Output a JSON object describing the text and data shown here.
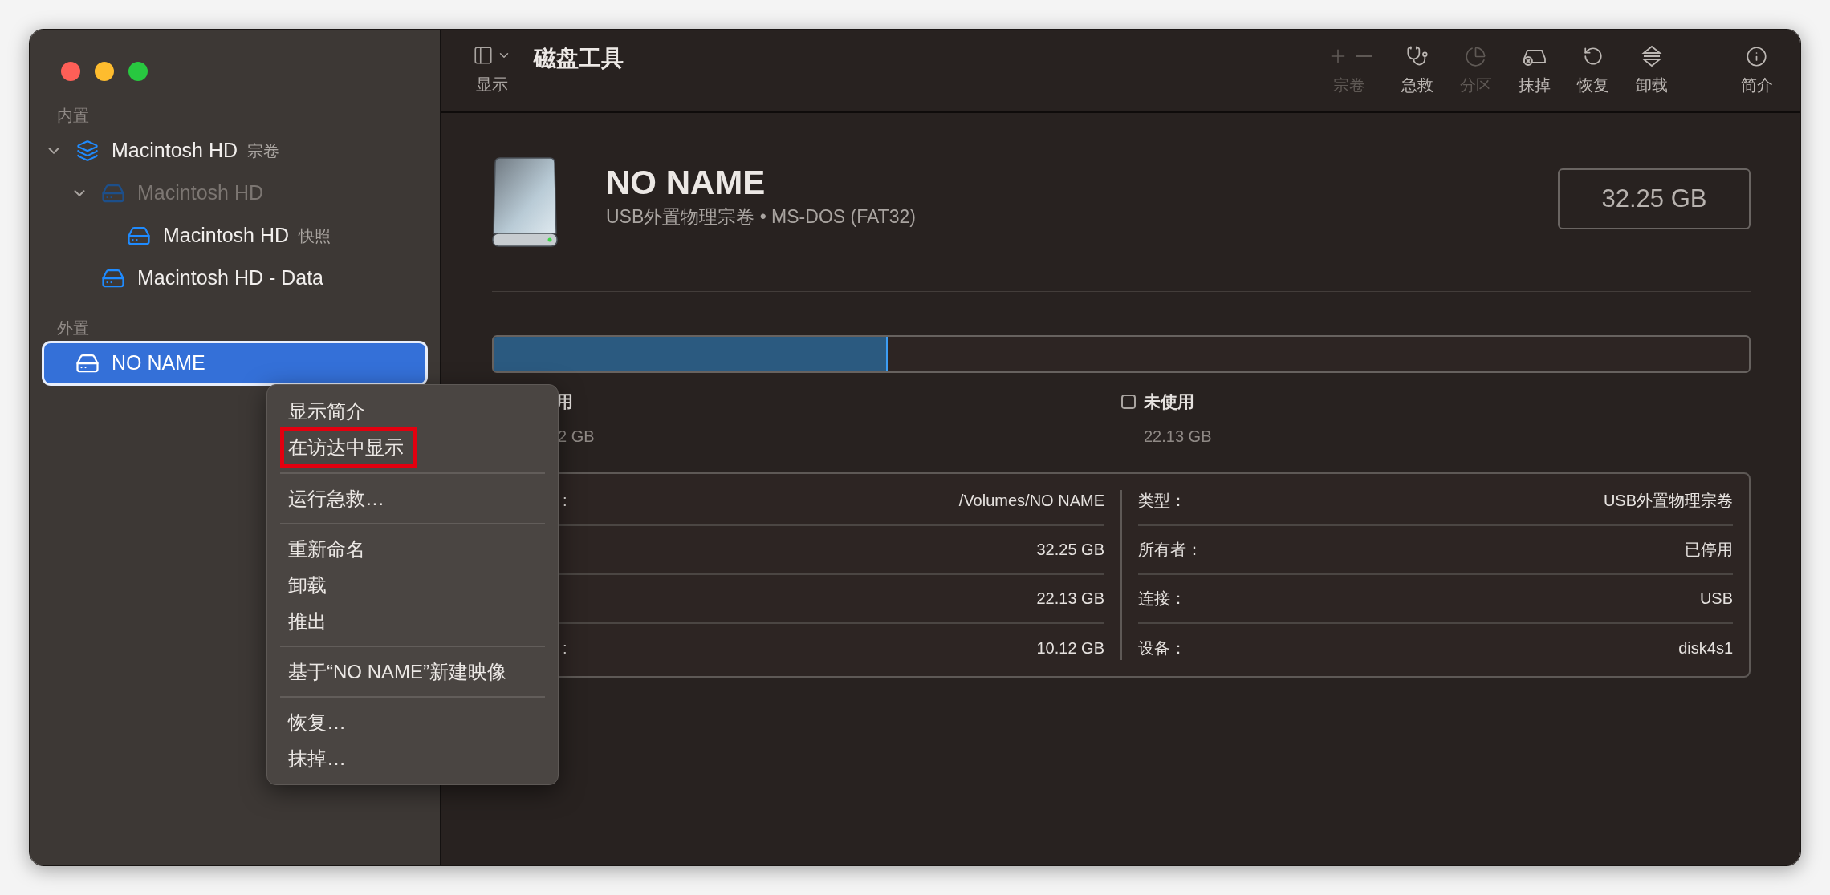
{
  "window": {
    "title": "磁盘工具"
  },
  "toolbar": {
    "view_label": "显示",
    "buttons": [
      {
        "kind": "volume",
        "label": "宗卷",
        "disabled": true
      },
      {
        "kind": "firstaid",
        "label": "急救",
        "disabled": false
      },
      {
        "kind": "partition",
        "label": "分区",
        "disabled": true
      },
      {
        "kind": "erase",
        "label": "抹掉",
        "disabled": false
      },
      {
        "kind": "restore",
        "label": "恢复",
        "disabled": false
      },
      {
        "kind": "unmount",
        "label": "卸载",
        "disabled": false
      },
      {
        "kind": "info",
        "label": "简介",
        "disabled": false
      }
    ]
  },
  "sidebar": {
    "sections": [
      {
        "title": "内置",
        "items": [
          {
            "kind": "container",
            "name": "Macintosh HD",
            "tag": "宗卷",
            "selected": false,
            "disabled": false,
            "expanded": true,
            "children": [
              {
                "kind": "volume",
                "name": "Macintosh HD",
                "selected": false,
                "disabled": true,
                "expanded": true,
                "children": [
                  {
                    "kind": "volume",
                    "name": "Macintosh HD",
                    "tag": "快照",
                    "selected": false,
                    "disabled": false
                  }
                ]
              },
              {
                "kind": "volume",
                "name": "Macintosh HD - Data",
                "selected": false,
                "disabled": false
              }
            ]
          }
        ]
      },
      {
        "title": "外置",
        "items": [
          {
            "kind": "external",
            "name": "NO NAME",
            "selected": true,
            "disabled": false
          }
        ]
      }
    ]
  },
  "volume": {
    "name": "NO NAME",
    "subtitle": "USB外置物理宗卷 • MS-DOS (FAT32)",
    "capacity": "32.25 GB",
    "usage": {
      "level": 0.314,
      "legend": [
        {
          "kind": "used",
          "label": "用",
          "value": "2 GB"
        },
        {
          "kind": "free",
          "label": "未使用",
          "value": "22.13 GB"
        }
      ]
    },
    "details_left": [
      {
        "label": ":",
        "value": "/Volumes/NO NAME"
      },
      {
        "value": "32.25 GB"
      },
      {
        "value": "22.13 GB"
      },
      {
        "label": ":",
        "value": "10.12 GB"
      }
    ],
    "details_right": [
      {
        "label": "类型：",
        "value": "USB外置物理宗卷"
      },
      {
        "label": "所有者：",
        "value": "已停用"
      },
      {
        "label": "连接：",
        "value": "USB"
      },
      {
        "label": "设备：",
        "value": "disk4s1"
      }
    ]
  },
  "context_menu": {
    "groups": [
      [
        {
          "label": "显示简介",
          "highlighted": false
        },
        {
          "label": "在访达中显示",
          "highlighted": true
        }
      ],
      [
        {
          "label": "运行急救…",
          "highlighted": false
        }
      ],
      [
        {
          "label": "重新命名",
          "highlighted": false
        },
        {
          "label": "卸载",
          "highlighted": false
        },
        {
          "label": "推出",
          "highlighted": false
        }
      ],
      [
        {
          "label": "基于“NO NAME”新建映像",
          "highlighted": false
        }
      ],
      [
        {
          "label": "恢复…",
          "highlighted": false
        },
        {
          "label": "抹掉…",
          "highlighted": false
        }
      ]
    ]
  }
}
